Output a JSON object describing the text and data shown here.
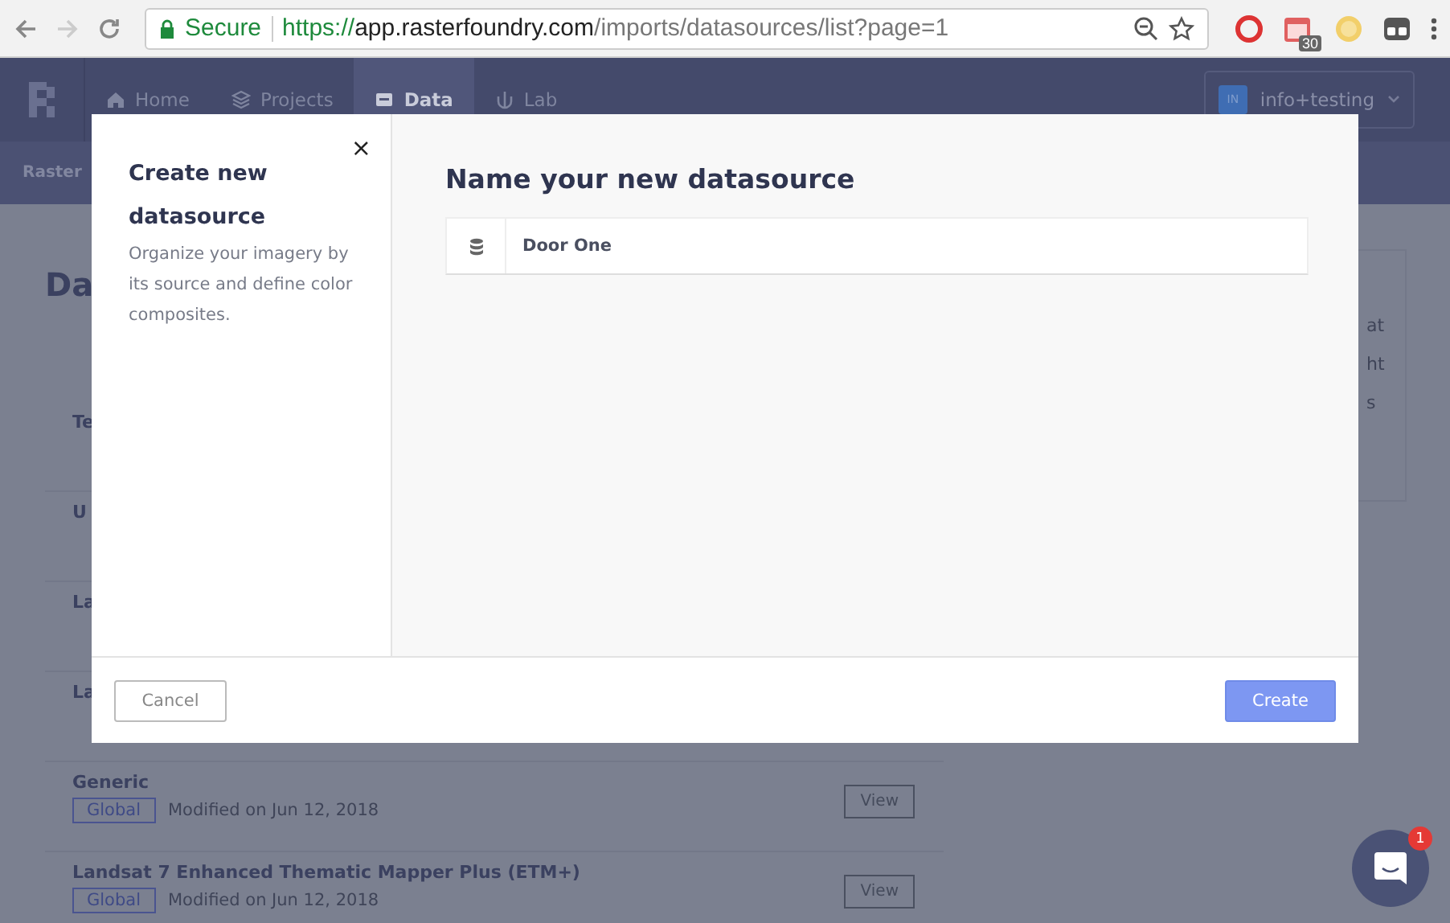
{
  "browser": {
    "security": "Secure",
    "url": {
      "scheme": "https://",
      "host": "app.rasterfoundry.com",
      "path": "/imports/datasources/list?page=1"
    },
    "extension_badge": "30"
  },
  "nav": {
    "items": [
      {
        "label": "Home",
        "selected": false
      },
      {
        "label": "Projects",
        "selected": false
      },
      {
        "label": "Data",
        "selected": true
      },
      {
        "label": "Lab",
        "selected": false
      }
    ],
    "user": {
      "initials": "IN",
      "name": "info+testing"
    }
  },
  "subnav": {
    "label": "Raster"
  },
  "page": {
    "heading": "Da",
    "rows": [
      {
        "title": "Te"
      },
      {
        "title": "U"
      },
      {
        "title": "La"
      },
      {
        "title": "La"
      },
      {
        "title": "Generic",
        "tag": "Global",
        "modified": "Modified on Jun 12, 2018",
        "action": "View"
      },
      {
        "title": "Landsat 7 Enhanced Thematic Mapper Plus (ETM+)",
        "tag": "Global",
        "modified": "Modified on Jun 12, 2018",
        "action": "View"
      }
    ],
    "side_card": {
      "lines": [
        "at",
        "ht",
        "s"
      ]
    }
  },
  "modal": {
    "title": "Create new datasource",
    "description": "Organize your imagery by its source and define color composites.",
    "close": "×",
    "heading": "Name your new datasource",
    "name_field": {
      "value": "Door One"
    },
    "cancel": "Cancel",
    "submit": "Create"
  },
  "chat": {
    "badge": "1"
  }
}
